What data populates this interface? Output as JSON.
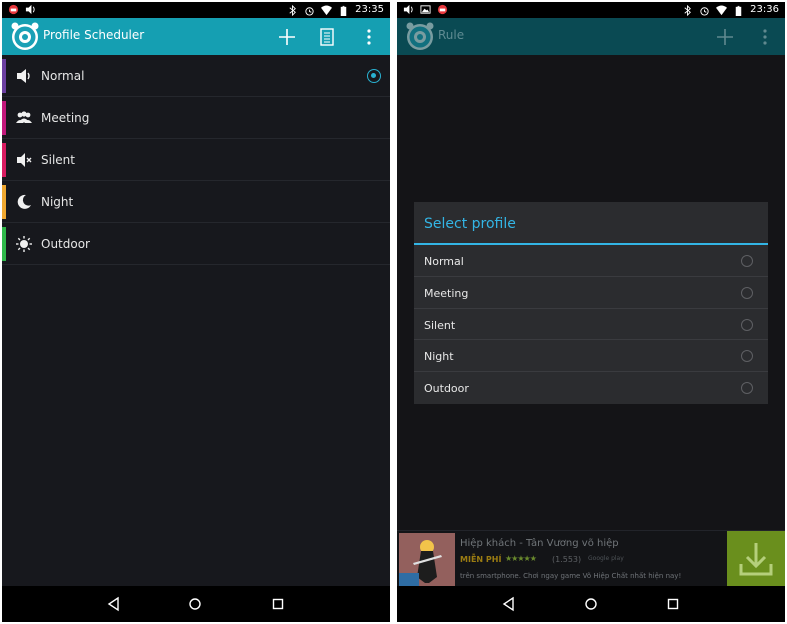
{
  "left_screen": {
    "status_bar": {
      "time": "23:35",
      "left_icons": [
        "notification-icon",
        "volume-icon"
      ],
      "right_icons": [
        "bluetooth-icon",
        "alarm-icon",
        "wifi-icon",
        "battery-icon"
      ]
    },
    "action_bar": {
      "title": "Profile Scheduler",
      "actions": [
        "add-icon",
        "list-icon",
        "overflow-menu-icon"
      ]
    },
    "profiles": [
      {
        "label": "Normal",
        "icon": "speaker-icon",
        "color": "#6b3fa0",
        "selected": true
      },
      {
        "label": "Meeting",
        "icon": "meeting-people-icon",
        "color": "#c2187b",
        "selected": false
      },
      {
        "label": "Silent",
        "icon": "mute-icon",
        "color": "#d81b60",
        "selected": false
      },
      {
        "label": "Night",
        "icon": "moon-icon",
        "color": "#f0a830",
        "selected": false
      },
      {
        "label": "Outdoor",
        "icon": "sun-icon",
        "color": "#2fb84a",
        "selected": false
      }
    ]
  },
  "right_screen": {
    "status_bar": {
      "time": "23:36",
      "left_icons": [
        "volume-icon",
        "image-icon",
        "notification-icon"
      ],
      "right_icons": [
        "bluetooth-icon",
        "alarm-icon",
        "wifi-icon",
        "battery-icon"
      ]
    },
    "action_bar": {
      "title": "Rule",
      "actions": [
        "add-icon",
        "overflow-menu-icon"
      ]
    },
    "dialog": {
      "title": "Select profile",
      "options": [
        "Normal",
        "Meeting",
        "Silent",
        "Night",
        "Outdoor"
      ]
    },
    "ad": {
      "title": "Hiệp khách - Tân Vương võ hiệp",
      "price": "MIỄN PHÍ",
      "stars": "★★★★★",
      "count": "(1.553)",
      "store": "Google play",
      "desc": "trên smartphone. Chơi ngay game Võ Hiệp Chất nhất hiện nay!"
    }
  },
  "nav_bar": {
    "buttons": [
      "back-icon",
      "home-icon",
      "recents-icon"
    ]
  },
  "colors": {
    "accent": "#159fb2",
    "dialog_accent": "#33b5e5",
    "background": "#17181d"
  }
}
